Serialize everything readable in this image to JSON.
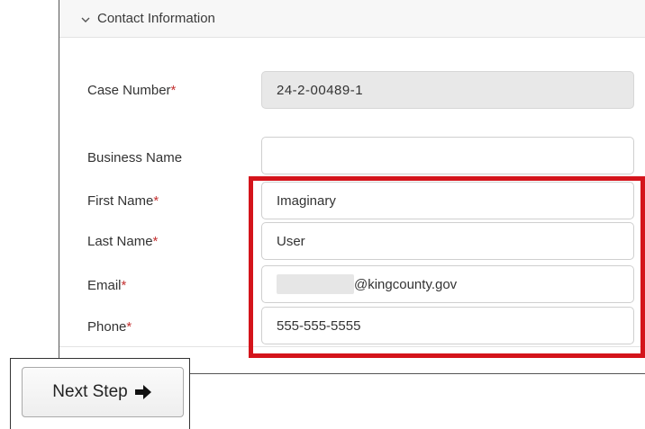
{
  "section": {
    "title": "Contact Information",
    "toggle_icon": "chevron-down-icon"
  },
  "fields": {
    "case_number": {
      "label": "Case Number",
      "required_mark": "*",
      "value": "24-2-00489-1"
    },
    "business_name": {
      "label": "Business Name",
      "value": ""
    },
    "first_name": {
      "label": "First Name",
      "required_mark": "*",
      "value": "Imaginary"
    },
    "last_name": {
      "label": "Last Name",
      "required_mark": "*",
      "value": "User"
    },
    "email": {
      "label": "Email",
      "required_mark": "*",
      "value_suffix": "@kingcounty.gov"
    },
    "phone": {
      "label": "Phone",
      "required_mark": "*",
      "value": "555-555-5555"
    }
  },
  "actions": {
    "next_step_label": "Next Step",
    "next_step_icon": "arrow-right-icon"
  },
  "colors": {
    "required": "#c43232",
    "highlight": "#d4141b",
    "readonly_bg": "#e8e8e8"
  }
}
